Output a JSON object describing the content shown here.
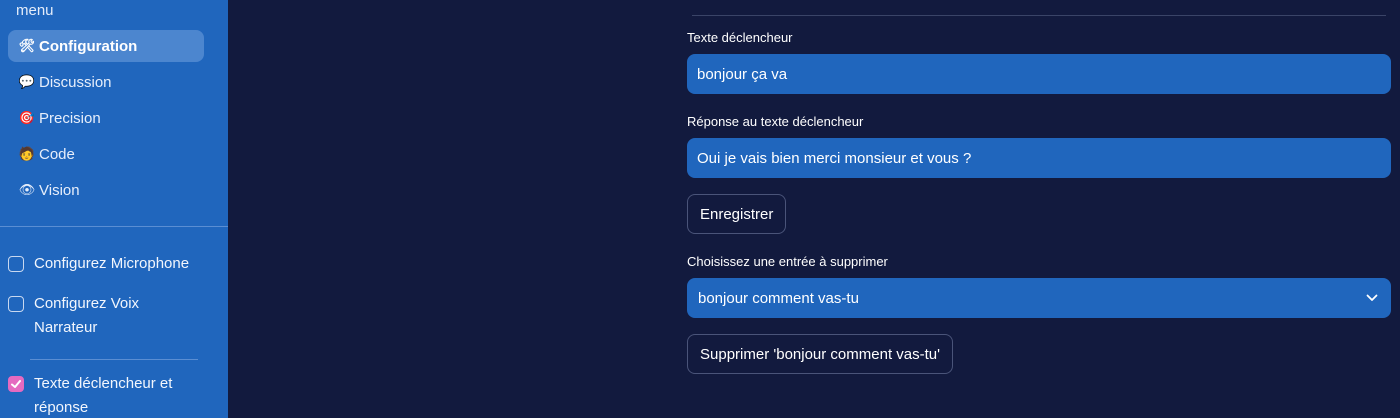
{
  "sidebar": {
    "heading": "menu",
    "items": [
      {
        "label": "Configuration",
        "icon": "tools-icon",
        "glyph": "🛠",
        "active": true
      },
      {
        "label": "Discussion",
        "icon": "speech-bubble-icon",
        "glyph": "💬",
        "active": false
      },
      {
        "label": "Precision",
        "icon": "target-icon",
        "glyph": "🎯",
        "active": false
      },
      {
        "label": "Code",
        "icon": "person-coding-icon",
        "glyph": "🧑",
        "active": false
      },
      {
        "label": "Vision",
        "icon": "eye-icon",
        "glyph": "👁",
        "active": false
      }
    ],
    "checkboxes": [
      {
        "label": "Configurez Microphone",
        "checked": false
      },
      {
        "label": "Configurez Voix Narrateur",
        "checked": false
      },
      {
        "label": "Texte déclencheur et réponse",
        "checked": true
      }
    ]
  },
  "main": {
    "trigger_label": "Texte déclencheur",
    "trigger_value": "bonjour ça va",
    "response_label": "Réponse au texte déclencheur",
    "response_value": "Oui je vais bien merci monsieur et vous ?",
    "save_button": "Enregistrer",
    "delete_select_label": "Choisissez une entrée à supprimer",
    "delete_select_value": "bonjour comment vas-tu",
    "delete_button": "Supprimer 'bonjour comment vas-tu'"
  },
  "colors": {
    "background": "#121a3e",
    "sidebar": "#2066bd",
    "accent": "#e56ac0"
  }
}
